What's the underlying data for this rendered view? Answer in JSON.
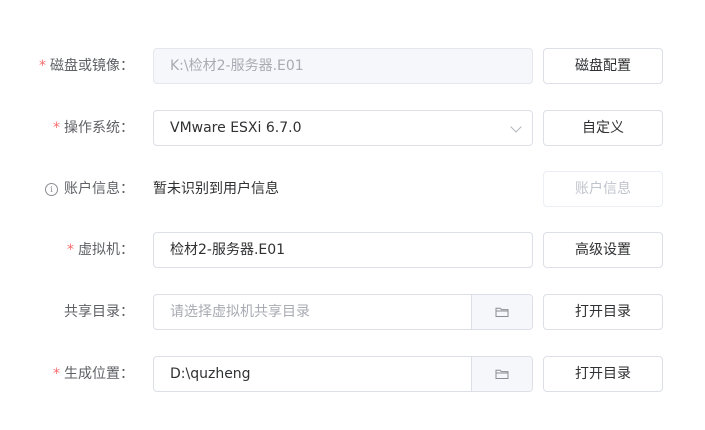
{
  "form": {
    "rows": [
      {
        "required": "*",
        "label": "磁盘或镜像：",
        "value": "K:\\检材2-服务器.E01",
        "button": "磁盘配置"
      },
      {
        "required": "*",
        "label": "操作系统：",
        "value": "VMware ESXi 6.7.0",
        "button": "自定义"
      },
      {
        "info_icon_text": "i",
        "label": "账户信息：",
        "value": "暂未识别到用户信息",
        "button": "账户信息"
      },
      {
        "required": "*",
        "label": "虚拟机：",
        "value": "检材2-服务器.E01",
        "button": "高级设置"
      },
      {
        "label": "共享目录：",
        "placeholder": "请选择虚拟机共享目录",
        "button": "打开目录"
      },
      {
        "required": "*",
        "label": "生成位置：",
        "value": "D:\\quzheng",
        "button": "打开目录"
      }
    ]
  },
  "icons": {
    "select_arrow": "chevron-down-icon",
    "folder": "folder-icon",
    "info": "info-icon"
  },
  "colors": {
    "required_asterisk": "#f56c6c",
    "border": "#dcdfe6",
    "disabled_bg": "#f5f7fa",
    "placeholder": "#a8abb2"
  }
}
